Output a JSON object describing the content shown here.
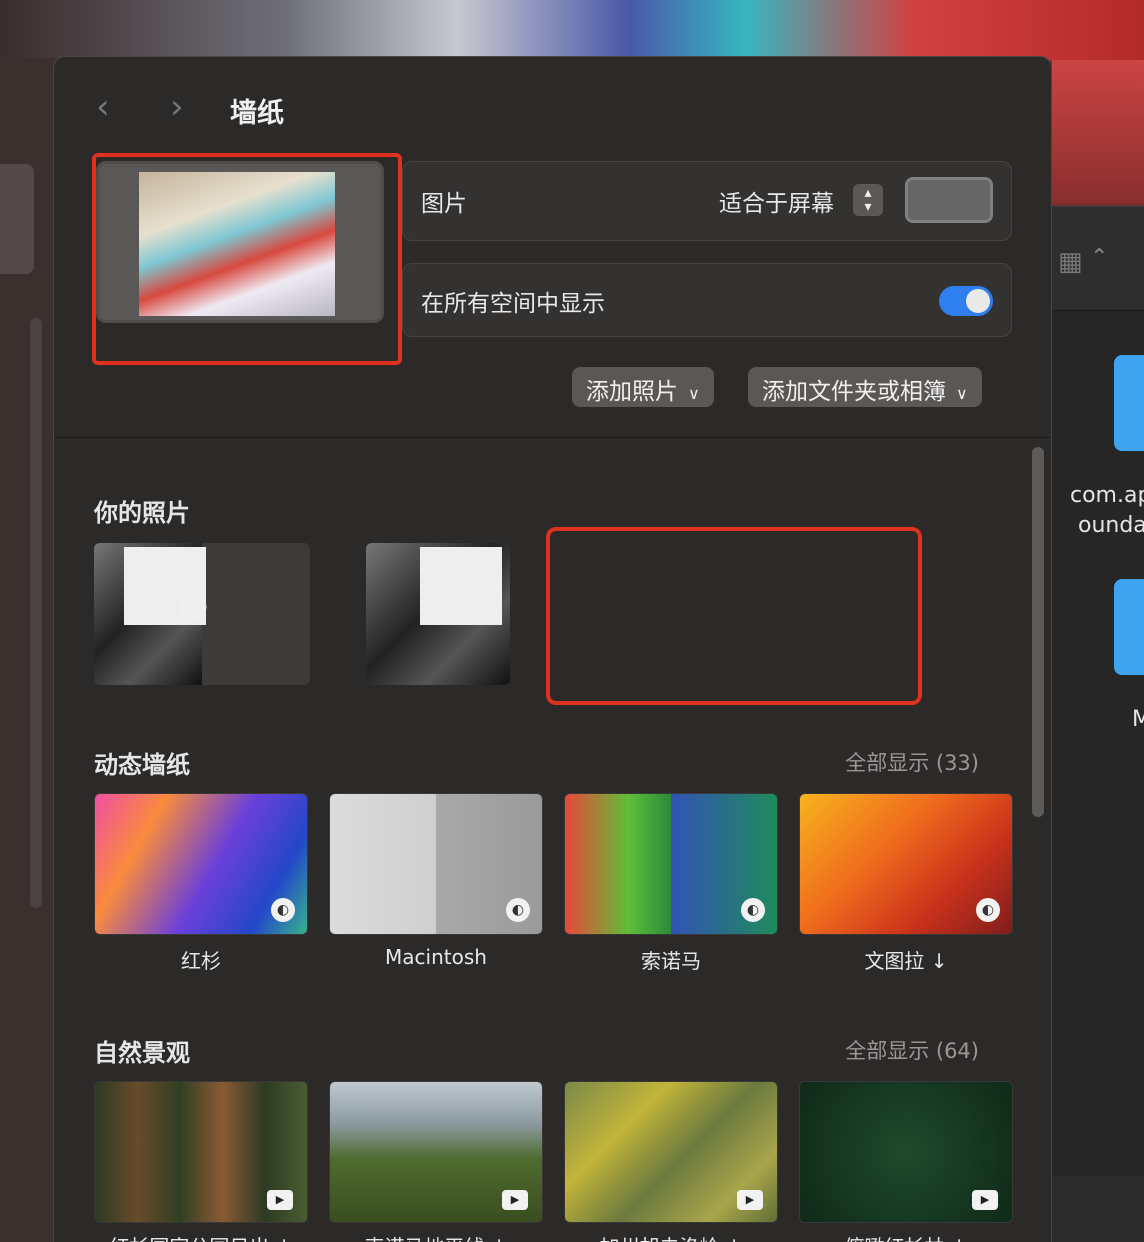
{
  "window": {
    "title": "墙纸",
    "back": "‹",
    "forward": "›"
  },
  "current": {
    "picture_label": "图片",
    "fit_option": "适合于屏幕",
    "stepper": "⌃⌄",
    "show_all_spaces_label": "在所有空间中显示",
    "show_all_spaces_on": true,
    "add_photo": "添加照片",
    "add_folder": "添加文件夹或相簿",
    "chevron": "⌄"
  },
  "your_photos": {
    "title": "你的照片"
  },
  "dynamic": {
    "title": "动态墙纸",
    "show_all": "全部显示 (33)",
    "items": [
      {
        "name": "红杉"
      },
      {
        "name": "Macintosh"
      },
      {
        "name": "索诺马"
      },
      {
        "name": "文图拉 ↓"
      }
    ]
  },
  "landscape": {
    "title": "自然景观",
    "show_all": "全部显示 (64)",
    "items": [
      {
        "name": "红杉国家公园日出 ↓"
      },
      {
        "name": "索诺马地平线 ↓"
      },
      {
        "name": "加州胡夫洛岭 ↓"
      },
      {
        "name": "俯瞰红杉林 ↓"
      }
    ]
  },
  "finder": {
    "file_label_1": "com.ap",
    "file_label_2": "ounda",
    "file_label_3": "M"
  },
  "colors": {
    "accent": "#2f7ff1",
    "highlight": "#e0301e"
  }
}
